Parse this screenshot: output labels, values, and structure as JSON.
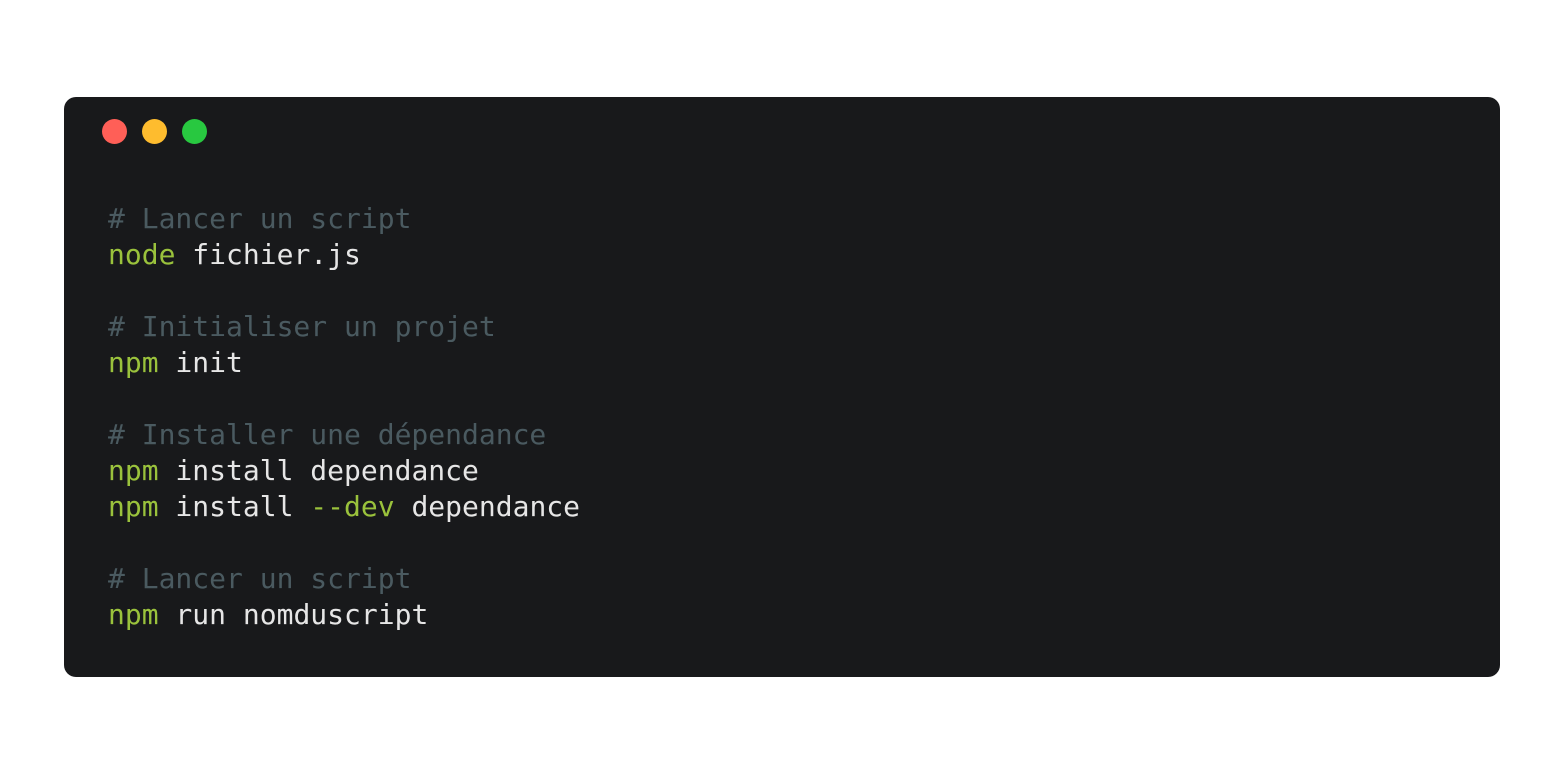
{
  "window": {
    "controls": [
      {
        "name": "close",
        "color": "#ff5f57"
      },
      {
        "name": "minimize",
        "color": "#febc2e"
      },
      {
        "name": "maximize",
        "color": "#28c840"
      }
    ]
  },
  "code": {
    "lines": [
      {
        "type": "comment",
        "text": "# Lancer un script"
      },
      {
        "type": "command",
        "cmd": "node",
        "args": " fichier.js"
      },
      {
        "type": "blank"
      },
      {
        "type": "comment",
        "text": "# Initialiser un projet"
      },
      {
        "type": "command",
        "cmd": "npm",
        "args": " init"
      },
      {
        "type": "blank"
      },
      {
        "type": "comment",
        "text": "# Installer une dépendance"
      },
      {
        "type": "command",
        "cmd": "npm",
        "args": " install dependance"
      },
      {
        "type": "command",
        "cmd": "npm",
        "args": " install ",
        "flag": "--dev",
        "after": " dependance"
      },
      {
        "type": "blank"
      },
      {
        "type": "comment",
        "text": "# Lancer un script"
      },
      {
        "type": "command",
        "cmd": "npm",
        "args": " run nomduscript"
      }
    ]
  },
  "colors": {
    "background": "#18191b",
    "comment": "#4a5a60",
    "command": "#9ac23c",
    "text": "#e6e6e6"
  }
}
